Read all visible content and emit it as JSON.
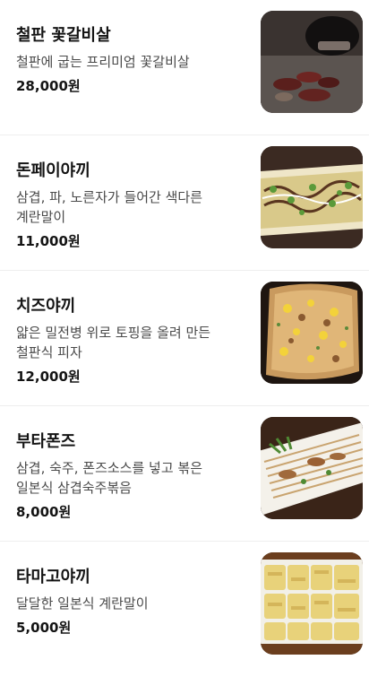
{
  "menu": {
    "items": [
      {
        "name": "철판 꽃갈비살",
        "description": "철판에 굽는 프리미엄 꽃갈비살",
        "price": "28,000원",
        "photo_icon": "grilled-beef-photo"
      },
      {
        "name": "돈페이야끼",
        "description": "삼겹, 파, 노른자가 들어간 색다른 계란말이",
        "price": "11,000원",
        "photo_icon": "tonpeiyaki-photo"
      },
      {
        "name": "치즈야끼",
        "description": "얇은 밀전병 위로 토핑을 올려 만든 철판식 피자",
        "price": "12,000원",
        "photo_icon": "cheese-yaki-photo"
      },
      {
        "name": "부타폰즈",
        "description": "삼겹, 숙주, 폰즈소스를 넣고 볶은 일본식 삼겹숙주볶음",
        "price": "8,000원",
        "photo_icon": "butaponzu-photo"
      },
      {
        "name": "타마고야끼",
        "description": "달달한 일본식 계란말이",
        "price": "5,000원",
        "photo_icon": "tamagoyaki-photo"
      }
    ]
  }
}
